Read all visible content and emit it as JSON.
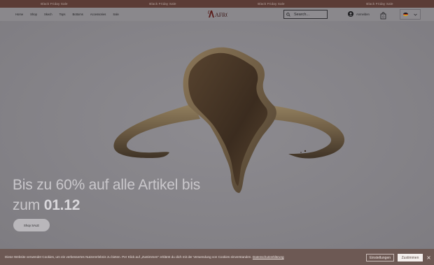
{
  "promo": {
    "items": [
      "Black Friday Sale",
      "Black Friday Sale",
      "Black Friday Sale",
      "Black Friday Sale"
    ]
  },
  "header": {
    "nav": [
      "Home",
      "Shop",
      "Skech",
      "Tops",
      "Bottoms",
      "Accessories",
      "Sale"
    ],
    "logo_text": "AFRO",
    "search_placeholder": "Search...",
    "login_label": "Anmelden",
    "cart_count": "0",
    "language_icon": "germany-flag-icon"
  },
  "hero": {
    "headline_part1": "Bis zu 60% auf alle Artikel bis zum ",
    "headline_bold": "01.12",
    "button_label": "Shop SALE"
  },
  "cookie": {
    "text": "Diese Website verwendet Cookies, um ein verbessertes Nutzererlebnis zu bieten. Per Klick auf „Zustimmen\" erklärst du dich mit der Verwendung von Cookies einverstanden.",
    "link": "Datenschutzerklärung",
    "settings_label": "Einstellungen",
    "accept_label": "Zustimmen",
    "close_icon": "close-icon"
  },
  "colors": {
    "promo_bg": "#5b3c36",
    "cookie_bg": "#6d5954",
    "hero_bg": "#848286"
  }
}
